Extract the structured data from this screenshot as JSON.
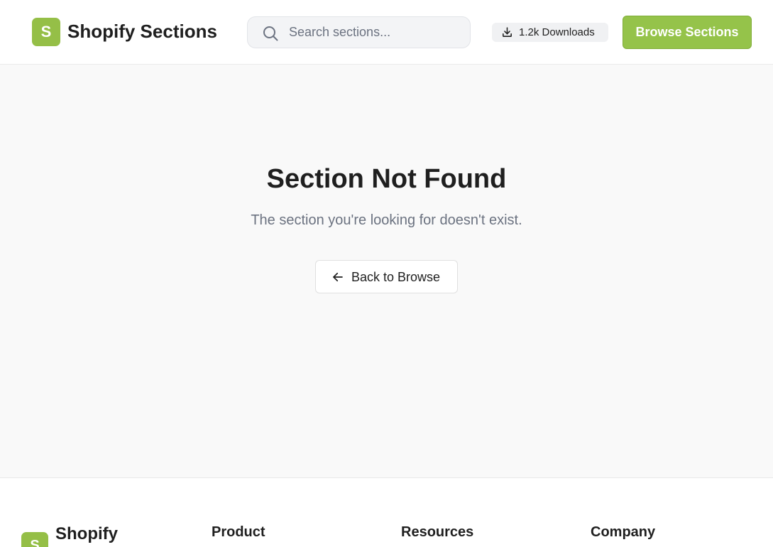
{
  "header": {
    "logo_letter": "S",
    "logo_text": "Shopify Sections",
    "search_placeholder": "Search sections...",
    "downloads_label": "1.2k Downloads",
    "browse_button": "Browse Sections"
  },
  "main": {
    "title": "Section Not Found",
    "subtitle": "The section you're looking for doesn't exist.",
    "back_button": "Back to Browse"
  },
  "footer": {
    "logo_letter": "S",
    "logo_text": "Shopify",
    "columns": [
      "Product",
      "Resources",
      "Company"
    ]
  },
  "colors": {
    "brand": "#95bf47",
    "page_bg": "#f9f9f9",
    "text": "#1f1f1f",
    "muted": "#6b7280"
  },
  "icons": {
    "search": "search-icon",
    "download": "download-icon",
    "back": "arrow-left-icon"
  }
}
